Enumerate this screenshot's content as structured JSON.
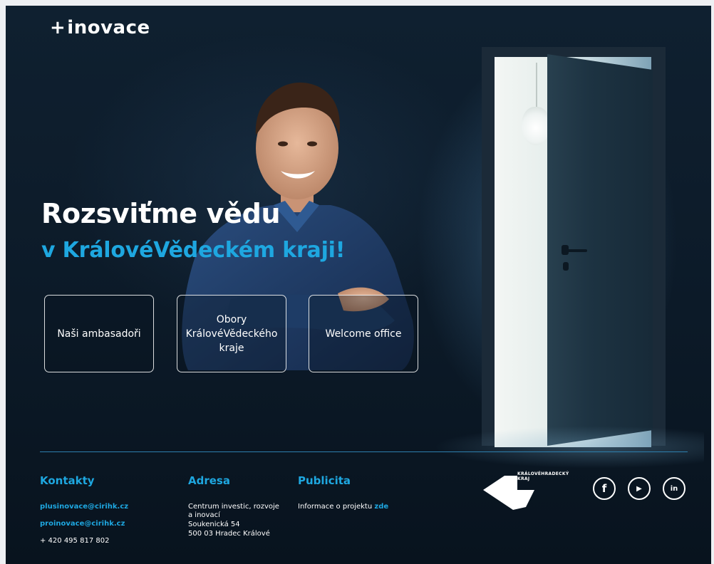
{
  "brand": {
    "logo_plus": "+",
    "logo_text": "inovace"
  },
  "hero": {
    "title": "Rozsviťme vědu",
    "subtitle": "v KrálovéVědeckém kraji!"
  },
  "cards": [
    {
      "label": "Naši ambasadoři"
    },
    {
      "label": "Obory KrálovéVědeckého kraje"
    },
    {
      "label": "Welcome office"
    }
  ],
  "footer": {
    "contacts": {
      "heading": "Kontakty",
      "email1": "plusinovace@cirihk.cz",
      "email2": "proinovace@cirihk.cz",
      "phone": "+ 420 495 817 802"
    },
    "address": {
      "heading": "Adresa",
      "line1": "Centrum investic, rozvoje",
      "line2": "a inovací",
      "line3": "Soukenická 54",
      "line4": "500 03 Hradec Králové"
    },
    "publicity": {
      "heading": "Publicita",
      "text": "Informace o projektu ",
      "link": "zde"
    },
    "region_logo": {
      "line1": "KRÁLOVÉHRADECKÝ",
      "line2": "KRAJ"
    },
    "social": [
      {
        "name": "facebook-icon",
        "glyph": "f"
      },
      {
        "name": "youtube-icon",
        "glyph": "▶"
      },
      {
        "name": "linkedin-icon",
        "glyph": "in"
      }
    ]
  },
  "colors": {
    "accent": "#1ea7e0",
    "background": "#0c1a28"
  }
}
